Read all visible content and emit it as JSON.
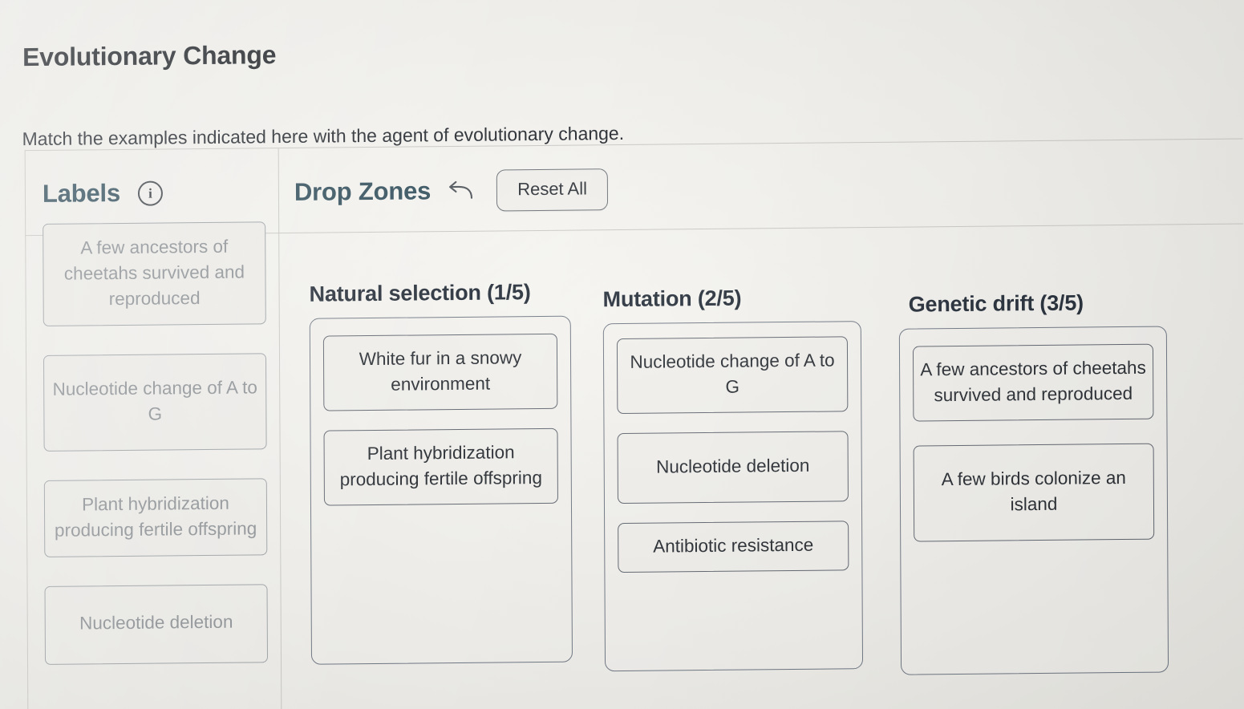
{
  "page": {
    "title": "Evolutionary Change",
    "instruction": "Match the examples indicated here with the agent of evolutionary change."
  },
  "labels_panel": {
    "header": "Labels",
    "info_icon": "info-circle-icon",
    "info_glyph": "i",
    "items": [
      {
        "text": "A few ancestors of cheetahs survived and reproduced"
      },
      {
        "text": "Nucleotide change of A to G"
      },
      {
        "text": "Plant hybridization producing fertile offspring"
      },
      {
        "text": "Nucleotide deletion"
      }
    ]
  },
  "drop_panel": {
    "header": "Drop Zones",
    "undo_icon": "undo-arrow-icon",
    "reset_label": "Reset All",
    "zones": [
      {
        "title": "Natural selection (1/5)",
        "cards": [
          {
            "text": "White fur in a snowy environment"
          },
          {
            "text": "Plant hybridization producing fertile offspring"
          }
        ]
      },
      {
        "title": "Mutation (2/5)",
        "cards": [
          {
            "text": "Nucleotide change of A to G"
          },
          {
            "text": "Nucleotide deletion"
          },
          {
            "text": "Antibiotic resistance"
          }
        ]
      },
      {
        "title": "Genetic drift (3/5)",
        "cards": [
          {
            "text": "A few ancestors of cheetahs survived and reproduced"
          },
          {
            "text": "A few birds colonize an island"
          }
        ]
      }
    ]
  },
  "colors": {
    "background": "#f1f0ec",
    "heading_text": "#1b1f24",
    "panel_header_text": "#2c4a58",
    "zone_title_text": "#1e2733",
    "label_card_text": "#8b9094",
    "drop_card_text": "#23282e",
    "card_border": "#9aa0a4",
    "zone_border": "#6b7480",
    "divider": "#c9c8c4"
  }
}
